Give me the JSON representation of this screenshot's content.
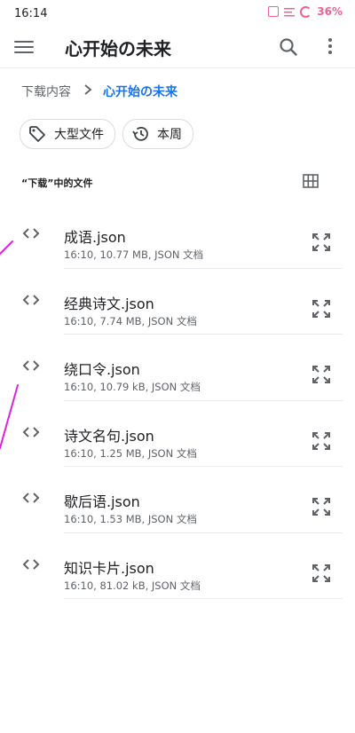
{
  "status_bar": {
    "time": "16:14",
    "battery": "36%"
  },
  "app_bar": {
    "title": "心开始の未来",
    "icons": [
      "menu-icon",
      "search-icon",
      "more-vert-icon"
    ]
  },
  "breadcrumb": {
    "root": "下载内容",
    "current": "心开始の未来"
  },
  "filters": [
    {
      "label": "大型文件",
      "icon": "tag-icon"
    },
    {
      "label": "本周",
      "icon": "history-icon"
    }
  ],
  "section": {
    "title": "“下载”中的文件",
    "view_toggle_icon": "grid-view-icon"
  },
  "files": [
    {
      "name": "成语.json",
      "meta": "16:10, 10.77 MB, JSON 文档"
    },
    {
      "name": "经典诗文.json",
      "meta": "16:10, 7.74 MB, JSON 文档"
    },
    {
      "name": "绕口令.json",
      "meta": "16:10, 10.79 kB, JSON 文档"
    },
    {
      "name": "诗文名句.json",
      "meta": "16:10, 1.25 MB, JSON 文档"
    },
    {
      "name": "歇后语.json",
      "meta": "16:10, 1.53 MB, JSON 文档"
    },
    {
      "name": "知识卡片.json",
      "meta": "16:10, 81.02 kB, JSON 文档"
    }
  ],
  "colors": {
    "accent": "#1a73e8",
    "status_pink": "#f06292",
    "annotation_magenta": "#e020e0"
  }
}
